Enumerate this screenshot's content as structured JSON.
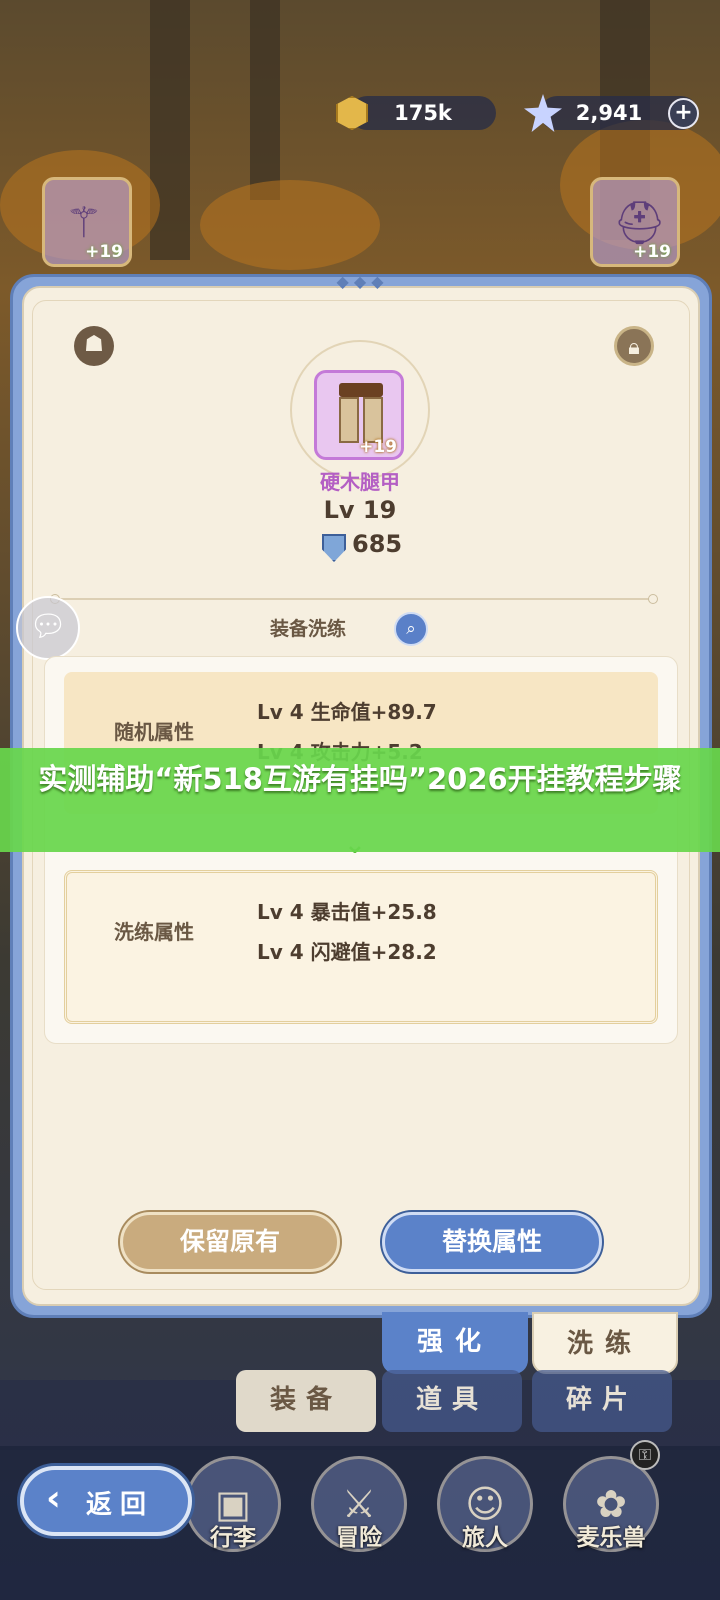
{
  "currency": {
    "coins": "175k",
    "gems": "2,941",
    "coin_icon": "gold-coin-icon",
    "gem_icon": "star-gem-icon",
    "add_icon": "+"
  },
  "side_slots": {
    "left_plus": "+19",
    "right_plus": "+19"
  },
  "item": {
    "name": "硬木腿甲",
    "level": "Lv 19",
    "power": "685",
    "enhance": "+19",
    "rarity_color": "#b45fc4"
  },
  "section": {
    "title": "装备洗练"
  },
  "random_attr": {
    "label": "随机属性",
    "lines": [
      "Lv 4  生命值+89.7",
      "Lv 4  攻击力+5.2"
    ]
  },
  "refine_attr": {
    "label": "洗练属性",
    "lines": [
      "Lv 4  暴击值+25.8",
      "Lv 4  闪避值+28.2"
    ]
  },
  "overlay": {
    "text": "实测辅助“新518互游有挂吗”2026开挂教程步骤"
  },
  "actions": {
    "keep": "保留原有",
    "replace": "替换属性"
  },
  "tabs": {
    "strengthen": "强化",
    "refine": "洗练"
  },
  "bottom_tabs": {
    "equip": "装备",
    "items": "道具",
    "shards": "碎片"
  },
  "nav": {
    "bag": "行李",
    "adventure": "冒险",
    "traveler": "旅人",
    "pet": "麦乐兽"
  },
  "back": {
    "label": "返回"
  },
  "colors": {
    "panel_blue": "#5b82c9",
    "panel_bg": "#f6efe0",
    "banner_green": "#68d64c"
  }
}
